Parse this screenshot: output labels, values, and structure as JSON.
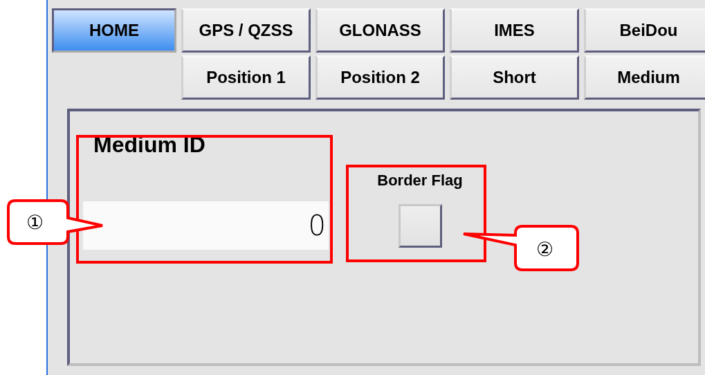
{
  "nav_rows": [
    [
      {
        "label": "HOME",
        "selected": true
      },
      {
        "label": "GPS / QZSS",
        "selected": false
      },
      {
        "label": "GLONASS",
        "selected": false
      },
      {
        "label": "IMES",
        "selected": false
      },
      {
        "label": "BeiDou",
        "selected": false
      }
    ],
    [
      {
        "label": "Position 1",
        "selected": false
      },
      {
        "label": "Position 2",
        "selected": false
      },
      {
        "label": "Short",
        "selected": false
      },
      {
        "label": "Medium",
        "selected": false
      }
    ]
  ],
  "medium_id": {
    "label": "Medium ID",
    "value": "0"
  },
  "border_flag": {
    "label": "Border Flag",
    "on": false
  },
  "callouts": [
    {
      "label": "①"
    },
    {
      "label": "②"
    }
  ]
}
